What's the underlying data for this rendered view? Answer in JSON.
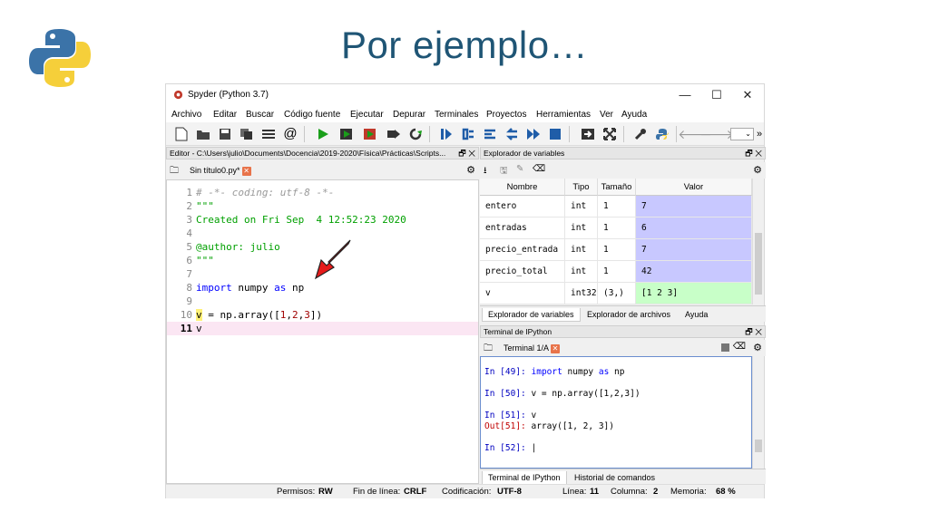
{
  "slide": {
    "title": "Por ejemplo…"
  },
  "window": {
    "title": "Spyder (Python 3.7)",
    "controls": {
      "minimize": "—",
      "maximize": "☐",
      "close": "✕"
    }
  },
  "menu": [
    "Archivo",
    "Editar",
    "Buscar",
    "Código fuente",
    "Ejecutar",
    "Depurar",
    "Terminales",
    "Proyectos",
    "Herramientas",
    "Ver",
    "Ayuda"
  ],
  "editor": {
    "pane_title": "Editor - C:\\Users\\julio\\Documents\\Docencia\\2019-2020\\Física\\Prácticas\\Scripts...",
    "tab_label": "Sin título0.py*",
    "lines": [
      {
        "num": "1",
        "text": "# -*- coding: utf-8 -*-"
      },
      {
        "num": "2",
        "text": "\"\"\""
      },
      {
        "num": "3",
        "text": "Created on Fri Sep  4 12:52:23 2020"
      },
      {
        "num": "4",
        "text": ""
      },
      {
        "num": "5",
        "text": "@author: julio"
      },
      {
        "num": "6",
        "text": "\"\"\""
      },
      {
        "num": "7",
        "text": ""
      },
      {
        "num": "8",
        "kw1": "import",
        "mid": " numpy ",
        "kw2": "as",
        "end": " np"
      },
      {
        "num": "9",
        "text": ""
      },
      {
        "num": "10",
        "pre": "v = np.array([",
        "n1": "1",
        "c1": ",",
        "n2": "2",
        "c2": ",",
        "n3": "3",
        "post": "])"
      },
      {
        "num": "11",
        "text": "v"
      }
    ]
  },
  "variables": {
    "pane_title": "Explorador de variables",
    "headers": [
      "Nombre",
      "Tipo",
      "Tamaño",
      "Valor"
    ],
    "rows": [
      {
        "name": "entero",
        "type": "int",
        "size": "1",
        "value": "7",
        "color": "#c8c8ff"
      },
      {
        "name": "entradas",
        "type": "int",
        "size": "1",
        "value": "6",
        "color": "#c8c8ff"
      },
      {
        "name": "precio_entrada",
        "type": "int",
        "size": "1",
        "value": "7",
        "color": "#c8c8ff"
      },
      {
        "name": "precio_total",
        "type": "int",
        "size": "1",
        "value": "42",
        "color": "#c8c8ff"
      },
      {
        "name": "v",
        "type": "int32",
        "size": "(3,)",
        "value": "[1 2 3]",
        "color": "#c8ffc8"
      }
    ],
    "bottom_tabs": [
      "Explorador de variables",
      "Explorador de archivos",
      "Ayuda"
    ]
  },
  "terminal": {
    "pane_title": "Terminal de IPython",
    "tab_label": "Terminal 1/A",
    "lines": [
      {
        "prompt": "In [49]:",
        "kw": "import",
        "rest": " numpy ",
        "kw2": "as",
        "rest2": " np"
      },
      {
        "prompt": "In [50]:",
        "code": " v = np.array([1,2,3])"
      },
      {
        "prompt": "In [51]:",
        "code": " v"
      },
      {
        "prompt": "Out[51]:",
        "code": " array([1, 2, 3])"
      },
      {
        "prompt": "In [52]:",
        "code": " |"
      }
    ],
    "bottom_tabs": [
      "Terminal de IPython",
      "Historial de comandos"
    ]
  },
  "status": {
    "permisos_label": "Permisos:",
    "permisos": "RW",
    "fin_label": "Fin de línea:",
    "fin": "CRLF",
    "cod_label": "Codificación:",
    "cod": "UTF-8",
    "linea_label": "Línea:",
    "linea": "11",
    "col_label": "Columna:",
    "col": "2",
    "mem_label": "Memoria:",
    "mem": "68 %"
  }
}
